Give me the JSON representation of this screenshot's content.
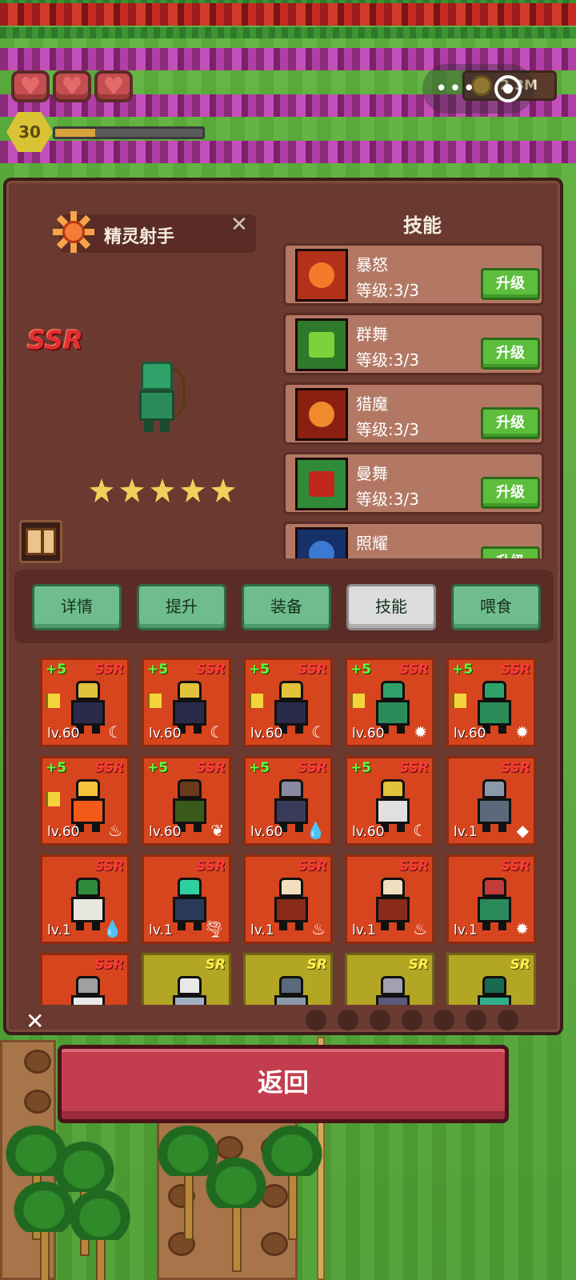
{
  "hud": {
    "hearts": [
      {
        "icon": "heart-icon",
        "glyph": "♥"
      },
      {
        "icon": "heart-icon",
        "glyph": "♥"
      },
      {
        "icon": "heart-icon",
        "glyph": "♥"
      }
    ],
    "player_level": "30",
    "xp_progress": 0.27,
    "currency_icon": "coin-icon",
    "currency_text": "2.3M",
    "capsule_dots": "•••"
  },
  "hero": {
    "name": "精灵射手",
    "close_glyph": "✕",
    "rarity": "SSR",
    "stars": 5,
    "element_icon": "sun-icon",
    "book_icon": "book-icon"
  },
  "skills": {
    "title": "技能",
    "upgrade_label": "升级",
    "items": [
      {
        "name": "暴怒",
        "level": "等级:3/3",
        "icon": "rage-icon",
        "bg": "#b3301a",
        "fg": "#f57a2a"
      },
      {
        "name": "群舞",
        "level": "等级:3/3",
        "icon": "arrow-up-icon",
        "bg": "#2f7a2a",
        "fg": "#7ad33a"
      },
      {
        "name": "猎魔",
        "level": "等级:3/3",
        "icon": "demon-eye-icon",
        "bg": "#8a1f12",
        "fg": "#f08a2a"
      },
      {
        "name": "曼舞",
        "level": "等级:3/3",
        "icon": "boot-icon",
        "bg": "#2f8a3a",
        "fg": "#c2281a"
      },
      {
        "name": "照耀",
        "level": "",
        "icon": "shield-icon",
        "bg": "#16306a",
        "fg": "#3a7ad3"
      }
    ]
  },
  "tabs": [
    {
      "label": "详情",
      "active": false
    },
    {
      "label": "提升",
      "active": false
    },
    {
      "label": "装备",
      "active": false
    },
    {
      "label": "技能",
      "active": true
    },
    {
      "label": "喂食",
      "active": false
    }
  ],
  "roster": [
    {
      "plus": "+5",
      "rarity": "SSR",
      "flag": true,
      "level": "lv.60",
      "element": "☾",
      "unit": "dark-knight",
      "body": "#2a2a4a",
      "accent": "#e2c23a"
    },
    {
      "plus": "+5",
      "rarity": "SSR",
      "flag": true,
      "level": "lv.60",
      "element": "☾",
      "unit": "dark-knight",
      "body": "#2a2a4a",
      "accent": "#e2c23a"
    },
    {
      "plus": "+5",
      "rarity": "SSR",
      "flag": true,
      "level": "lv.60",
      "element": "☾",
      "unit": "dark-knight",
      "body": "#2a2a4a",
      "accent": "#e2c23a"
    },
    {
      "plus": "+5",
      "rarity": "SSR",
      "flag": true,
      "level": "lv.60",
      "element": "✹",
      "unit": "elf-archer",
      "body": "#2b8c5a",
      "accent": "#2fa26a"
    },
    {
      "plus": "+5",
      "rarity": "SSR",
      "flag": true,
      "level": "lv.60",
      "element": "✹",
      "unit": "elf-archer",
      "body": "#2b8c5a",
      "accent": "#2fa26a"
    },
    {
      "plus": "+5",
      "rarity": "SSR",
      "flag": true,
      "level": "lv.60",
      "element": "♨",
      "unit": "fire-elemental",
      "body": "#f25a1a",
      "accent": "#f6c23a"
    },
    {
      "plus": "+5",
      "rarity": "SSR",
      "flag": false,
      "level": "lv.60",
      "element": "❦",
      "unit": "treant",
      "body": "#3a5a1a",
      "accent": "#6a3a1a"
    },
    {
      "plus": "+5",
      "rarity": "SSR",
      "flag": false,
      "level": "lv.60",
      "element": "💧",
      "unit": "serpent",
      "body": "#3a3a5a",
      "accent": "#8a8aa0"
    },
    {
      "plus": "+5",
      "rarity": "SSR",
      "flag": false,
      "level": "lv.60",
      "element": "☾",
      "unit": "skeleton-king",
      "body": "#e0e0e0",
      "accent": "#e2c23a"
    },
    {
      "plus": "",
      "rarity": "SSR",
      "flag": false,
      "level": "lv.1",
      "element": "◆",
      "unit": "stone-golem",
      "body": "#5a6a7a",
      "accent": "#8a9aaa"
    },
    {
      "plus": "",
      "rarity": "SSR",
      "flag": false,
      "level": "lv.1",
      "element": "💧",
      "unit": "druid",
      "body": "#e8e8e0",
      "accent": "#2f8a3a"
    },
    {
      "plus": "",
      "rarity": "SSR",
      "flag": false,
      "level": "lv.1",
      "element": "🌪",
      "unit": "wind-spirit",
      "body": "#2a3a5a",
      "accent": "#2fd0a0"
    },
    {
      "plus": "",
      "rarity": "SSR",
      "flag": false,
      "level": "lv.1",
      "element": "♨",
      "unit": "minotaur",
      "body": "#8a2a1a",
      "accent": "#f0e0c0"
    },
    {
      "plus": "",
      "rarity": "SSR",
      "flag": false,
      "level": "lv.1",
      "element": "♨",
      "unit": "minotaur",
      "body": "#8a2a1a",
      "accent": "#f0e0c0"
    },
    {
      "plus": "",
      "rarity": "SSR",
      "flag": false,
      "level": "lv.1",
      "element": "✹",
      "unit": "orc-shaman",
      "body": "#2a8a5a",
      "accent": "#c23a3a"
    },
    {
      "plus": "",
      "rarity": "SSR",
      "flag": false,
      "level": "",
      "element": "",
      "unit": "wolf",
      "body": "#e8e8e8",
      "accent": "#a0a0a0"
    },
    {
      "plus": "",
      "rarity": "SR",
      "flag": false,
      "level": "",
      "element": "",
      "unit": "cat",
      "body": "#a0b0c0",
      "accent": "#e8e8e8"
    },
    {
      "plus": "",
      "rarity": "SR",
      "flag": false,
      "level": "",
      "element": "",
      "unit": "rock",
      "body": "#8a9aaa",
      "accent": "#5a6a7a"
    },
    {
      "plus": "",
      "rarity": "SR",
      "flag": false,
      "level": "",
      "element": "",
      "unit": "serpent",
      "body": "#5a5a7a",
      "accent": "#a0a0b0"
    },
    {
      "plus": "",
      "rarity": "SR",
      "flag": false,
      "level": "",
      "element": "",
      "unit": "slime",
      "body": "#2fb08a",
      "accent": "#1a6a50"
    }
  ],
  "filters": [
    "fire-filter-icon",
    "earth-filter-icon",
    "water-filter-icon",
    "wind-filter-icon",
    "flame-filter-icon",
    "sun-filter-icon",
    "moon-filter-icon"
  ],
  "filter_close": "✕",
  "return_label": "返回"
}
